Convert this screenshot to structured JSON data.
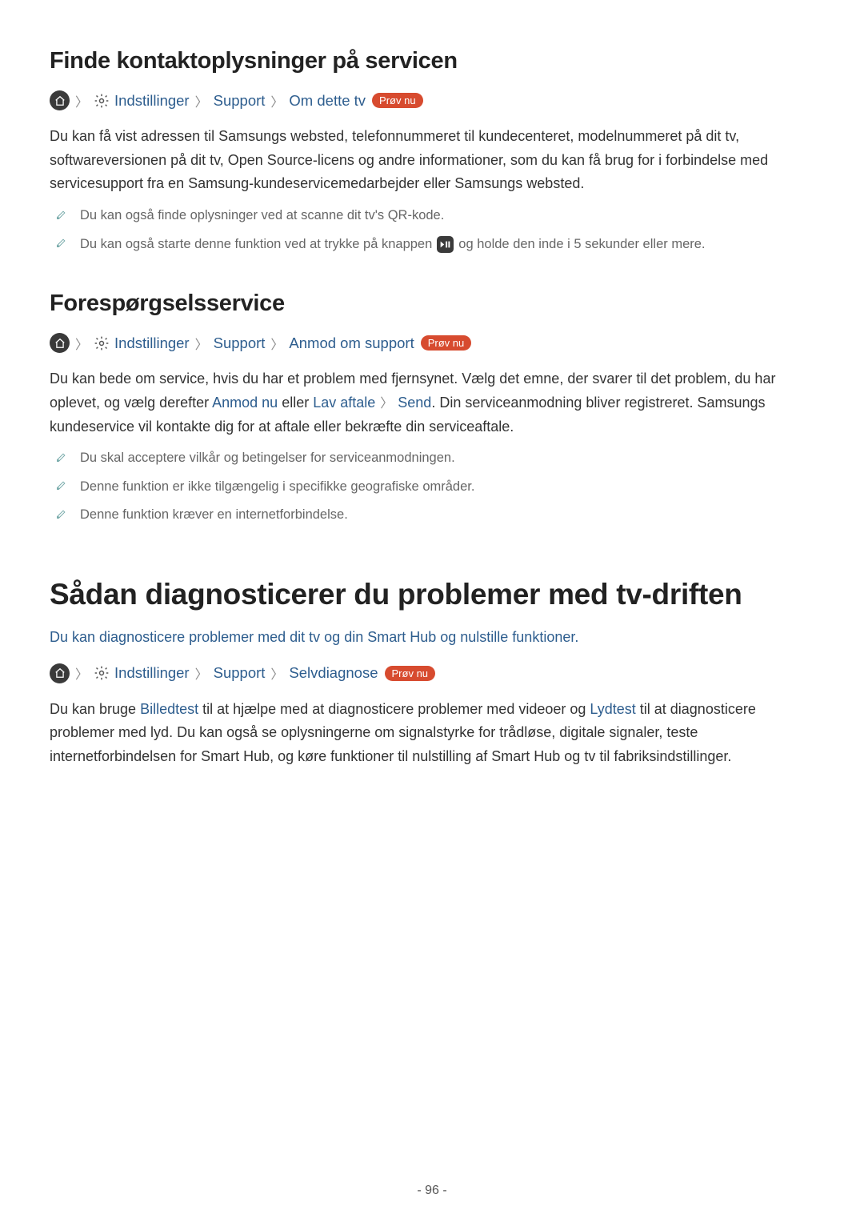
{
  "section1": {
    "heading": "Finde kontaktoplysninger på servicen",
    "breadcrumb": {
      "item1": "Indstillinger",
      "item2": "Support",
      "item3": "Om dette tv",
      "badge": "Prøv nu"
    },
    "paragraph": "Du kan få vist adressen til Samsungs websted, telefonnummeret til kundecenteret, modelnummeret på dit tv, softwareversionen på dit tv, Open Source-licens og andre informationer, som du kan få brug for i forbindelse med servicesupport fra en Samsung-kundeservicemedarbejder eller Samsungs websted.",
    "note1": "Du kan også finde oplysninger ved at scanne dit tv's QR-kode.",
    "note2_pre": "Du kan også starte denne funktion ved at trykke på knappen",
    "note2_post": "og holde den inde i 5 sekunder eller mere."
  },
  "section2": {
    "heading": "Forespørgselsservice",
    "breadcrumb": {
      "item1": "Indstillinger",
      "item2": "Support",
      "item3": "Anmod om support",
      "badge": "Prøv nu"
    },
    "para_pre": "Du kan bede om service, hvis du har et problem med fjernsynet. Vælg det emne, der svarer til det problem, du har oplevet, og vælg derefter ",
    "link1": "Anmod nu",
    "mid1": " eller ",
    "link2": "Lav aftale",
    "link3": "Send",
    "post": ". Din serviceanmodning bliver registreret. Samsungs kundeservice vil kontakte dig for at aftale eller bekræfte din serviceaftale.",
    "note1": "Du skal acceptere vilkår og betingelser for serviceanmodningen.",
    "note2": "Denne funktion er ikke tilgængelig i specifikke geografiske områder.",
    "note3": "Denne funktion kræver en internetforbindelse."
  },
  "section3": {
    "heading": "Sådan diagnosticerer du problemer med tv-driften",
    "subtitle": "Du kan diagnosticere problemer med dit tv og din Smart Hub og nulstille funktioner.",
    "breadcrumb": {
      "item1": "Indstillinger",
      "item2": "Support",
      "item3": "Selvdiagnose",
      "badge": "Prøv nu"
    },
    "para_pre": "Du kan bruge ",
    "link1": "Billedtest",
    "mid1": " til at hjælpe med at diagnosticere problemer med videoer og ",
    "link2": "Lydtest",
    "post": " til at diagnosticere problemer med lyd. Du kan også se oplysningerne om signalstyrke for trådløse, digitale signaler, teste internetforbindelsen for Smart Hub, og køre funktioner til nulstilling af Smart Hub og tv til fabriksindstillinger."
  },
  "pageNumber": "- 96 -"
}
